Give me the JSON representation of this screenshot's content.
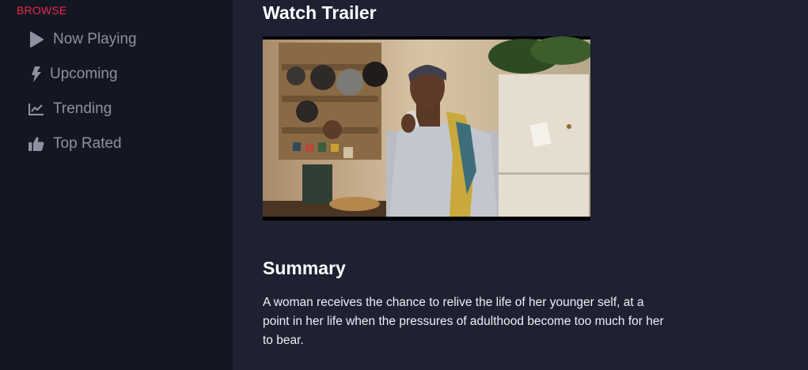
{
  "sidebar": {
    "heading": "BROWSE",
    "accent_color": "#e8284f",
    "items": [
      {
        "label": "Now Playing",
        "icon": "play-icon"
      },
      {
        "label": "Upcoming",
        "icon": "bolt-icon"
      },
      {
        "label": "Trending",
        "icon": "trending-chart-icon"
      },
      {
        "label": "Top Rated",
        "icon": "thumbs-up-icon"
      }
    ]
  },
  "main": {
    "trailer_title": "Watch Trailer",
    "summary_title": "Summary",
    "summary_text": "A woman receives the chance to relive the life of her younger self, at a point in her life when the pressures of adulthood become too much for her to bear."
  }
}
